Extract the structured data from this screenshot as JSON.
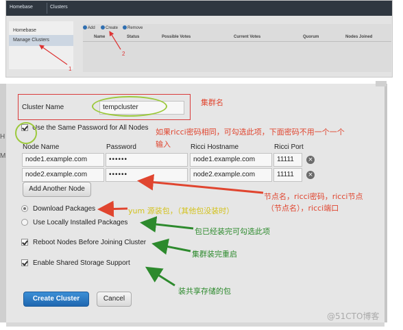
{
  "dashboard": {
    "breadcrumb": [
      "Homebase",
      "Clusters"
    ],
    "sidebar": [
      "Homebase",
      "Manage Clusters"
    ],
    "toolbar": [
      "Add",
      "Create",
      "Remove"
    ],
    "columns": [
      "Name",
      "Status",
      "Possible Votes",
      "Current Votes",
      "Quorum",
      "Nodes Joined"
    ],
    "markers": [
      "1",
      "2"
    ]
  },
  "dialog": {
    "stray_letters": [
      "H",
      "M"
    ],
    "cluster_name_label": "Cluster Name",
    "cluster_name_value": "tempcluster",
    "same_password_label": "Use the Same Password for All Nodes",
    "headers": {
      "node_name": "Node Name",
      "password": "Password",
      "ricci_hostname": "Ricci Hostname",
      "ricci_port": "Ricci Port"
    },
    "nodes": [
      {
        "name": "node1.example.com",
        "password": "••••••",
        "hostname": "node1.example.com",
        "port": "11111"
      },
      {
        "name": "node2.example.com",
        "password": "••••••",
        "hostname": "node2.example.com",
        "port": "11111"
      }
    ],
    "add_node_label": "Add Another Node",
    "download_packages": "Download Packages",
    "use_local_packages": "Use Locally Installed Packages",
    "reboot_nodes": "Reboot Nodes Before Joining Cluster",
    "shared_storage": "Enable Shared Storage Support",
    "create_label": "Create Cluster",
    "cancel_label": "Cancel"
  },
  "annotations": {
    "cluster_name": "集群名",
    "same_password_1": "如果ricci密码相同，可勾选此项，下面密码不用一个一个",
    "same_password_2": "输入",
    "node_info_1": "节点名，ricci密码，ricci节点",
    "node_info_2": "（节点名），ricci端口",
    "yum_source": "yum 源装包，（其他包没装时）",
    "installed": "包已经装完可勾选此项",
    "reboot": "集群装完重启",
    "shared_storage": "装共享存储的包"
  },
  "watermark": "@51CTO博客",
  "colors": {
    "annotation_red": "#e0452f",
    "annotation_green": "#2d8a2d",
    "annotation_yellow": "#d3c21d",
    "primary_button": "#2a78c4"
  }
}
